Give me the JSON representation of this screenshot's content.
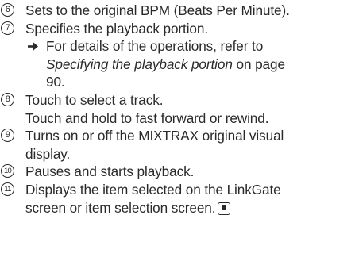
{
  "items": [
    {
      "num": "6",
      "text": "Sets to the original BPM (Beats Per Minute)."
    },
    {
      "num": "7",
      "text": "Specifies the playback portion.",
      "ref_prefix": "For details of the operations, refer to",
      "ref_link": "Specifying the playback portion",
      "ref_suffix": " on page",
      "ref_page": "90."
    },
    {
      "num": "8",
      "text": "Touch to select a track.",
      "text2": "Touch and hold to fast forward or rewind."
    },
    {
      "num": "9",
      "text": "Turns on or off the MIXTRAX original visual",
      "text2": "display."
    },
    {
      "num": "10",
      "text": "Pauses and starts playback."
    },
    {
      "num": "11",
      "text": "Displays the item selected on the LinkGate",
      "text2": "screen or item selection screen."
    }
  ],
  "icons": {
    "reference": "right-arrow-reference-icon",
    "end_mark": "stop-square-icon"
  }
}
